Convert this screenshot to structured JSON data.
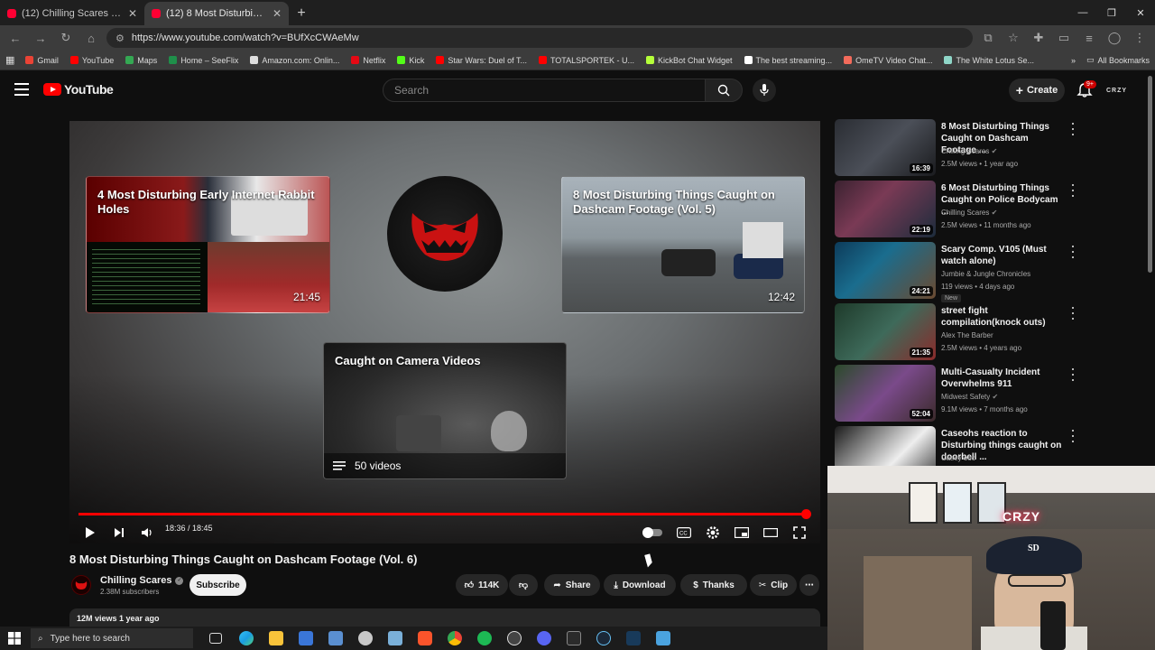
{
  "browser": {
    "tabs": [
      {
        "title": "(12) Chilling Scares - YouTube",
        "active": false
      },
      {
        "title": "(12) 8 Most Disturbing Things C",
        "active": true
      }
    ],
    "url": "https://www.youtube.com/watch?v=BUfXcCWAeMw",
    "bookmarks": [
      {
        "label": "Gmail",
        "color": "#ea4335"
      },
      {
        "label": "YouTube",
        "color": "#ff0000"
      },
      {
        "label": "Maps",
        "color": "#34a853"
      },
      {
        "label": "Home – SeeFlix",
        "color": "#1f8f4a"
      },
      {
        "label": "Amazon.com: Onlin...",
        "color": "#dddddd"
      },
      {
        "label": "Netflix",
        "color": "#e50914"
      },
      {
        "label": "Kick",
        "color": "#53fc18"
      },
      {
        "label": "Star Wars: Duel of T...",
        "color": "#ff0000"
      },
      {
        "label": "TOTALSPORTEK - U...",
        "color": "#ff0000"
      },
      {
        "label": "KickBot Chat Widget",
        "color": "#b5ff3a"
      },
      {
        "label": "The best streaming...",
        "color": "#ffffff"
      },
      {
        "label": "OmeTV Video Chat...",
        "color": "#f36b5b"
      },
      {
        "label": "The White Lotus Se...",
        "color": "#8fd6c8"
      }
    ],
    "all_bookmarks": "All Bookmarks"
  },
  "header": {
    "logo": "YouTube",
    "search_placeholder": "Search",
    "create": "Create",
    "notif_badge": "9+",
    "account": "CRZY"
  },
  "player": {
    "endcards": [
      {
        "title": "4 Most Disturbing Early Internet Rabbit Holes",
        "duration": "21:45"
      },
      {
        "title": "8 Most Disturbing Things Caught on Dashcam Footage (Vol. 5)",
        "duration": "12:42"
      }
    ],
    "playlist": {
      "title": "Caught on Camera Videos",
      "count": "50 videos"
    },
    "time": "18:36 / 18:45",
    "progress": 0.992
  },
  "video": {
    "title": "8 Most Disturbing Things Caught on Dashcam Footage (Vol. 6)",
    "channel": "Chilling Scares",
    "subscribers": "2.38M subscribers",
    "subscribe": "Subscribe",
    "likes": "114K",
    "share": "Share",
    "download": "Download",
    "thanks": "Thanks",
    "clip": "Clip",
    "views_date": "12M views  1 year ago"
  },
  "recommendations": [
    {
      "title": "8 Most Disturbing Things Caught on Dashcam Footage ...",
      "channel": "Chilling Scares",
      "verified": true,
      "meta": "2.5M views • 1 year ago",
      "duration": "16:39",
      "new": ""
    },
    {
      "title": "6 Most Disturbing Things Caught on Police Bodycam ...",
      "channel": "Chilling Scares",
      "verified": true,
      "meta": "2.5M views • 11 months ago",
      "duration": "22:19",
      "new": ""
    },
    {
      "title": "Scary Comp. V105 (Must watch alone)",
      "channel": "Jumbie & Jungle Chronicles",
      "verified": false,
      "meta": "119 views • 4 days ago",
      "duration": "24:21",
      "new": "New"
    },
    {
      "title": "street fight compilation(knock outs)",
      "channel": "Alex The Barber",
      "verified": false,
      "meta": "2.5M views • 4 years ago",
      "duration": "21:35",
      "new": ""
    },
    {
      "title": "Multi-Casualty Incident Overwhelms 911",
      "channel": "Midwest Safety",
      "verified": true,
      "meta": "9.1M views • 7 months ago",
      "duration": "52:04",
      "new": ""
    },
    {
      "title": "Caseohs reaction to Disturbing things caught on doorbell ...",
      "channel": "Casey ooo",
      "verified": false,
      "meta": "",
      "duration": "",
      "new": ""
    }
  ],
  "webcam": {
    "neon": "CRZY"
  },
  "taskbar": {
    "search": "Type here to search"
  }
}
